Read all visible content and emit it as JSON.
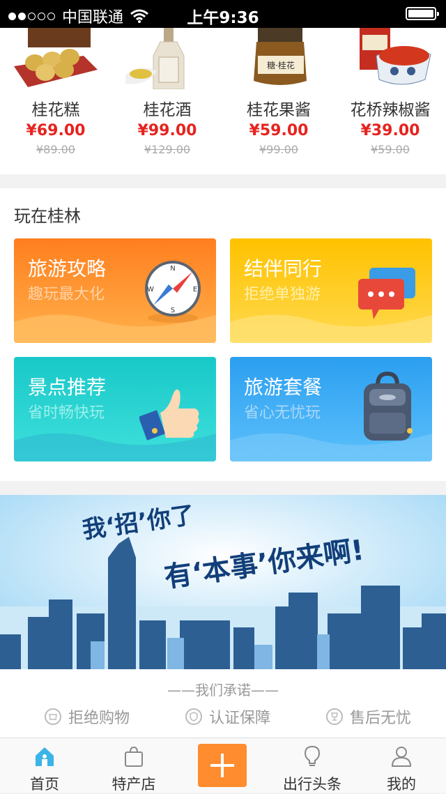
{
  "status": {
    "carrier": "中国联通",
    "time": "上午9:36"
  },
  "products": [
    {
      "name": "桂花糕",
      "price": "¥69.00",
      "old_price": "¥89.00"
    },
    {
      "name": "桂花酒",
      "price": "¥99.00",
      "old_price": "¥129.00"
    },
    {
      "name": "桂花果酱",
      "price": "¥59.00",
      "old_price": "¥99.00"
    },
    {
      "name": "花桥辣椒酱",
      "price": "¥39.00",
      "old_price": "¥59.00"
    }
  ],
  "product_labels": {
    "jam_jar": "糖·桂花"
  },
  "play": {
    "title": "玩在桂林",
    "cards": [
      {
        "title": "旅游攻略",
        "subtitle": "趣玩最大化",
        "color_top": "#ff7e1f",
        "color_bottom": "#ffb14a",
        "icon": "compass-icon"
      },
      {
        "title": "结伴同行",
        "subtitle": "拒绝单独游",
        "color_top": "#ffc200",
        "color_bottom": "#ffd94f",
        "icon": "chat-icon"
      },
      {
        "title": "景点推荐",
        "subtitle": "省时畅快玩",
        "color_top": "#18c8c8",
        "color_bottom": "#3fe0dc",
        "icon": "thumbs-up-icon"
      },
      {
        "title": "旅游套餐",
        "subtitle": "省心无忧玩",
        "color_top": "#2c9ff0",
        "color_bottom": "#5cc0fb",
        "icon": "backpack-icon"
      }
    ],
    "compass_letters": {
      "n": "N",
      "s": "S",
      "e": "E",
      "w": "W"
    }
  },
  "banner": {
    "line1": "我‘招’你了",
    "line2": "有‘本事’你来啊!"
  },
  "promise": {
    "title": "——我们承诺——",
    "items": [
      {
        "label": "拒绝购物",
        "icon": "no-shopping-icon"
      },
      {
        "label": "认证保障",
        "icon": "shield-icon"
      },
      {
        "label": "售后无忧",
        "icon": "trophy-icon"
      }
    ]
  },
  "tabs": [
    {
      "label": "首页",
      "icon": "home-icon",
      "active": true
    },
    {
      "label": "特产店",
      "icon": "bag-icon"
    },
    {
      "label": "",
      "icon": "plus-icon"
    },
    {
      "label": "出行头条",
      "icon": "bulb-icon"
    },
    {
      "label": "我的",
      "icon": "user-icon"
    }
  ],
  "colors": {
    "accent": "#ff8c2f",
    "price": "#e6231f",
    "active_tab": "#3bb4e8"
  }
}
